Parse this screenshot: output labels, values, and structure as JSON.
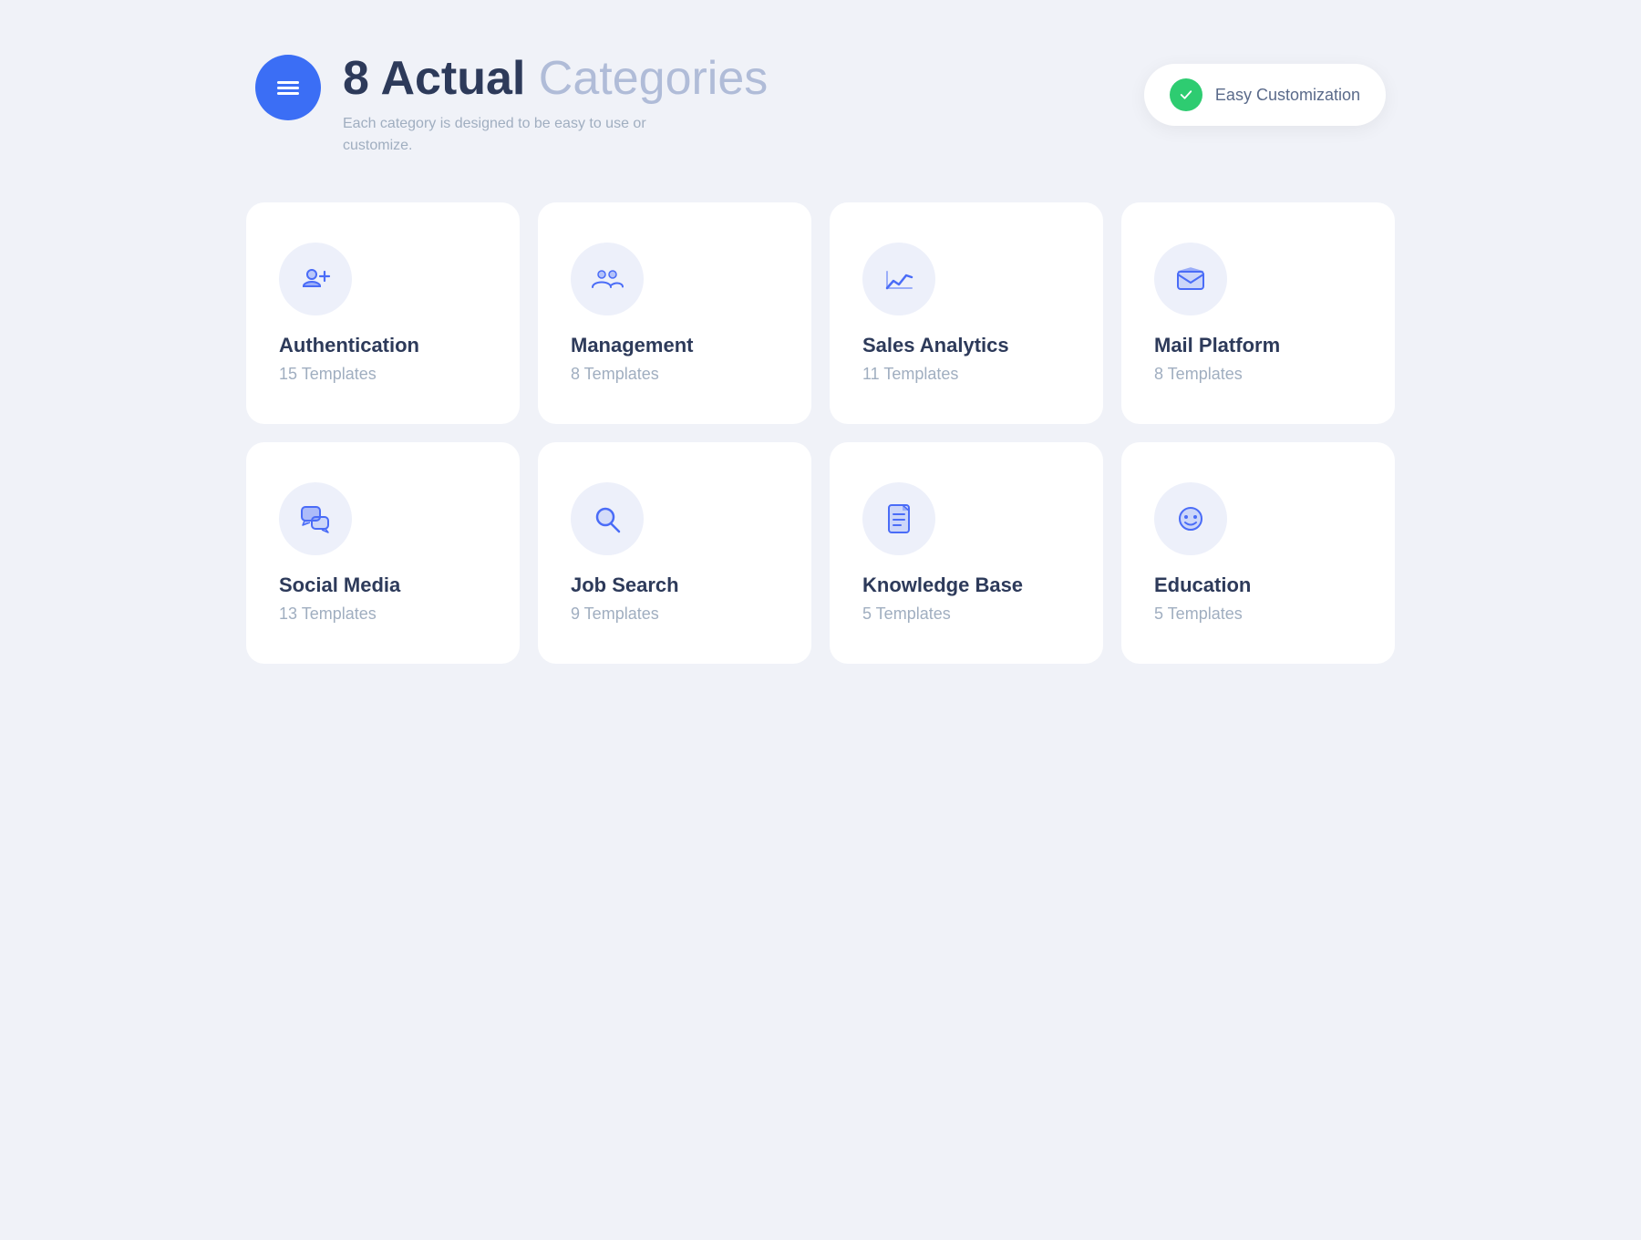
{
  "header": {
    "title_bold": "8 Actual",
    "title_light": " Categories",
    "subtitle": "Each category is designed to be easy to use or customize.",
    "badge_text": "Easy Customization"
  },
  "cards": [
    {
      "id": "authentication",
      "title": "Authentication",
      "count": "15 Templates",
      "icon": "user-plus"
    },
    {
      "id": "management",
      "title": "Management",
      "count": "8 Templates",
      "icon": "users"
    },
    {
      "id": "sales-analytics",
      "title": "Sales Analytics",
      "count": "11 Templates",
      "icon": "chart"
    },
    {
      "id": "mail-platform",
      "title": "Mail Platform",
      "count": "8 Templates",
      "icon": "mail"
    },
    {
      "id": "social-media",
      "title": "Social Media",
      "count": "13 Templates",
      "icon": "chat"
    },
    {
      "id": "job-search",
      "title": "Job Search",
      "count": "9 Templates",
      "icon": "search"
    },
    {
      "id": "knowledge-base",
      "title": "Knowledge Base",
      "count": "5 Templates",
      "icon": "document"
    },
    {
      "id": "education",
      "title": "Education",
      "count": "5 Templates",
      "icon": "face"
    }
  ]
}
